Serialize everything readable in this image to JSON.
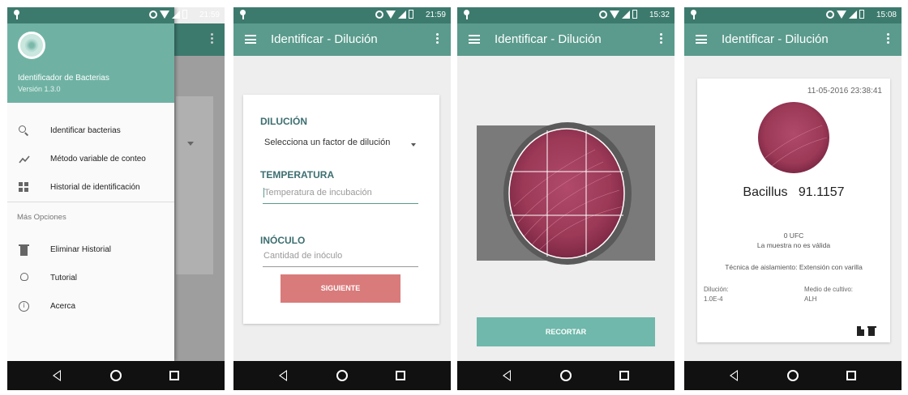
{
  "status_bar": {
    "times": [
      "21:59",
      "21:59",
      "15:32",
      "15:08"
    ]
  },
  "drawer": {
    "app_name": "Identificador de Bacterias",
    "version": "Versión 1.3.0",
    "items": [
      {
        "label": "Identificar bacterias",
        "icon": "search-icon"
      },
      {
        "label": "Método variable de conteo",
        "icon": "trend-line-icon"
      },
      {
        "label": "Historial de identificación",
        "icon": "dashboard-icon"
      }
    ],
    "more_label": "Más Opciones",
    "more_items": [
      {
        "label": "Eliminar Historial",
        "icon": "trash-icon"
      },
      {
        "label": "Tutorial",
        "icon": "lightbulb-icon"
      },
      {
        "label": "Acerca",
        "icon": "info-icon"
      }
    ]
  },
  "appbar": {
    "title": "Identificar - Dilución"
  },
  "form": {
    "dilution_label": "DILUCIÓN",
    "dilution_select": "Selecciona un factor de dilución",
    "temperature_label": "TEMPERATURA",
    "temperature_placeholder": "Temperatura de incubación",
    "inoculum_label": "INÓCULO",
    "inoculum_placeholder": "Cantidad de inóculo",
    "next_button": "SIGUIENTE"
  },
  "crop": {
    "button": "RECORTAR"
  },
  "result": {
    "datetime": "11-05-2016 23:38:41",
    "bacteria": "Bacillus",
    "score": "91.1157",
    "ufc": "0 UFC",
    "validity": "La muestra no es válida",
    "technique": "Técnica de aislamiento: Extensión con varilla",
    "dilution_label": "Dilución:",
    "dilution_value": "1.0E-4",
    "medium_label": "Medio de cultivo:",
    "medium_value": "ALH"
  },
  "colors": {
    "primary": "#5a9b8d",
    "primary_dark": "#3d7a6e",
    "accent_button": "#d97b7b",
    "crop_button": "#6fb8ab",
    "section_label": "#3d6e70"
  }
}
